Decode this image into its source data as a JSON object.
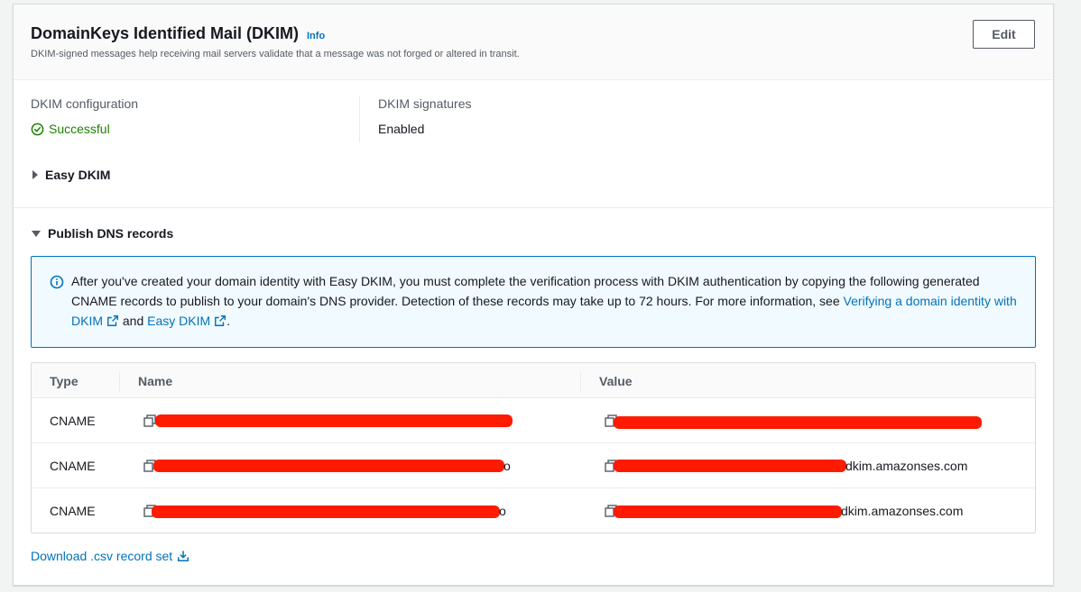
{
  "panel": {
    "title": "DomainKeys Identified Mail (DKIM)",
    "info_label": "Info",
    "description": "DKIM-signed messages help receiving mail servers validate that a message was not forged or altered in transit.",
    "edit_label": "Edit"
  },
  "summary": {
    "config_label": "DKIM configuration",
    "config_value": "Successful",
    "signatures_label": "DKIM signatures",
    "signatures_value": "Enabled"
  },
  "sections": {
    "easy_dkim": "Easy DKIM",
    "publish_dns": "Publish DNS records"
  },
  "alert": {
    "text_before": "After you've created your domain identity with Easy DKIM, you must complete the verification process with DKIM authentication by copying the following generated CNAME records to publish to your domain's DNS provider. Detection of these records may take up to 72 hours. For more information, see ",
    "link1": "Verifying a domain identity with DKIM",
    "middle": " and ",
    "link2": "Easy DKIM",
    "end": "."
  },
  "table": {
    "columns": [
      "Type",
      "Name",
      "Value"
    ],
    "rows": [
      {
        "type": "CNAME",
        "name_suffix": "",
        "value_suffix": ""
      },
      {
        "type": "CNAME",
        "name_suffix": "o",
        "value_suffix": "dkim.amazonses.com"
      },
      {
        "type": "CNAME",
        "name_suffix": "o",
        "value_suffix": "dkim.amazonses.com"
      }
    ]
  },
  "download_label": "Download .csv record set",
  "colors": {
    "link": "#0073bb",
    "success": "#1d8102",
    "redaction": "#ff1a00"
  },
  "icons": {
    "config_status": "check-circle-icon",
    "alert": "info-circle-icon",
    "copy": "copy-icon",
    "external": "external-link-icon",
    "download": "download-icon"
  }
}
